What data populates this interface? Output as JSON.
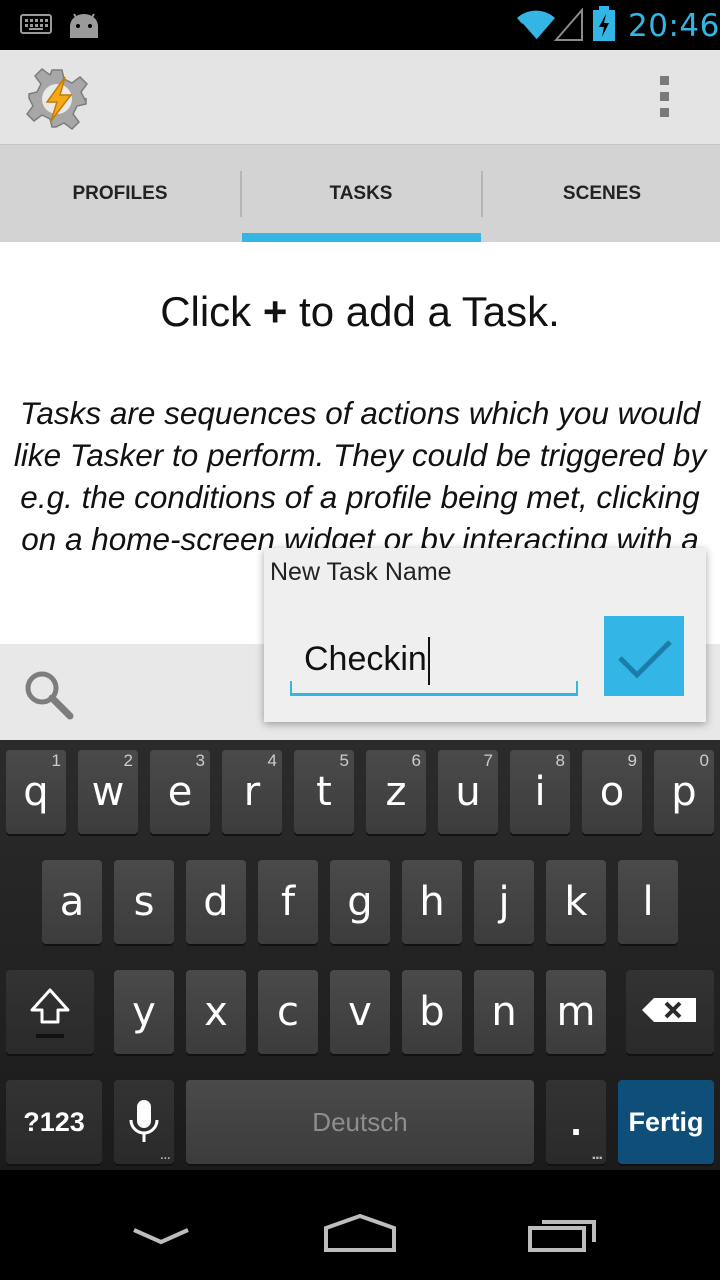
{
  "status_bar": {
    "time": "20:46",
    "icons": [
      "keyboard-icon",
      "android-debug-icon",
      "wifi-icon",
      "signal-icon",
      "battery-charging-icon"
    ],
    "accent": "#33b5e5"
  },
  "action_bar": {
    "icon": "tasker-app-icon",
    "overflow_icon": "overflow-menu-icon"
  },
  "tabs": [
    {
      "label": "PROFILES",
      "selected": false
    },
    {
      "label": "TASKS",
      "selected": true
    },
    {
      "label": "SCENES",
      "selected": false
    }
  ],
  "content": {
    "heading_pre": "Click ",
    "heading_plus": "+",
    "heading_post": " to add a Task.",
    "description": "Tasks are sequences of actions which you would like Tasker to perform. They could be triggered by e.g. the conditions of a profile being met, clicking on a home-screen widget or by interacting with a scene."
  },
  "search": {
    "icon": "search-icon"
  },
  "dialog": {
    "title": "New Task Name",
    "input_value": "Checkin",
    "confirm_icon": "checkmark-icon"
  },
  "keyboard": {
    "row1": [
      {
        "l": "q",
        "h": "1"
      },
      {
        "l": "w",
        "h": "2"
      },
      {
        "l": "e",
        "h": "3"
      },
      {
        "l": "r",
        "h": "4"
      },
      {
        "l": "t",
        "h": "5"
      },
      {
        "l": "z",
        "h": "6"
      },
      {
        "l": "u",
        "h": "7"
      },
      {
        "l": "i",
        "h": "8"
      },
      {
        "l": "o",
        "h": "9"
      },
      {
        "l": "p",
        "h": "0"
      }
    ],
    "row2": [
      "a",
      "s",
      "d",
      "f",
      "g",
      "h",
      "j",
      "k",
      "l"
    ],
    "row3": [
      "y",
      "x",
      "c",
      "v",
      "b",
      "n",
      "m"
    ],
    "symbols_label": "?123",
    "space_label": "Deutsch",
    "period_label": ".",
    "enter_label": "Fertig"
  },
  "nav_bar": {
    "icons": [
      "back-icon",
      "home-icon",
      "recent-apps-icon"
    ]
  }
}
